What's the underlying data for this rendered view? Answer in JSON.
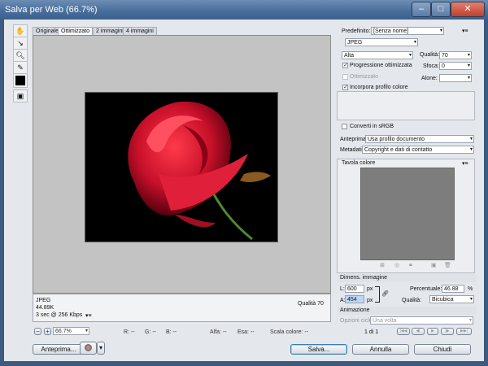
{
  "window": {
    "title": "Salva per Web (66.7%)",
    "minimize": "–",
    "maximize": "□",
    "close": "✕"
  },
  "tools": [
    "hand-icon",
    "slice-select-icon",
    "zoom-icon",
    "eyedropper-icon",
    "color-swatch-icon",
    "toggle-slices-icon"
  ],
  "tabs": [
    {
      "label": "Originale",
      "active": false
    },
    {
      "label": "Ottimizzato",
      "active": true
    },
    {
      "label": "2 immagini",
      "active": false
    },
    {
      "label": "4 immagini",
      "active": false
    }
  ],
  "info": {
    "format": "JPEG",
    "size": "44.89K",
    "time": "3 sec @ 256 Kbps",
    "quality": "Qualità 70"
  },
  "status": {
    "zoom": "66.7%",
    "r": "R: --",
    "g": "G: --",
    "b": "B: --",
    "alpha": "Alfa: --",
    "hex": "Esa: --",
    "index": "Scala colore: --"
  },
  "settings": {
    "preset_label": "Predefinito:",
    "preset_value": "[Senza nome]",
    "format": "JPEG",
    "compression": "Alta",
    "quality_label": "Qualità:",
    "quality_value": "70",
    "blur_label": "Sfoca:",
    "blur_value": "0",
    "matte_label": "Alone:",
    "progressive": "Progressione ottimizzata",
    "optimized": "Ottimizzato",
    "icc": "Incorpora profilo colore",
    "srgb": "Converti in sRGB",
    "preview_label": "Anteprima:",
    "preview_value": "Usa profilo documento",
    "metadata_label": "Metadati:",
    "metadata_value": "Copyright e dati di contatto"
  },
  "color_table": {
    "title": "Tavola colore"
  },
  "image_size": {
    "title": "Dimens. immagine",
    "w_label": "L:",
    "w_value": "600",
    "w_unit": "px",
    "h_label": "A:",
    "h_value": "454",
    "h_unit": "px",
    "percent_label": "Percentuale:",
    "percent_value": "46.88",
    "percent_unit": "%",
    "quality_label": "Qualità:",
    "quality_value": "Bicubica"
  },
  "animation": {
    "title": "Animazione",
    "loop_label": "Opzioni ciclo:",
    "loop_value": "Una volta",
    "frame": "1 di 1"
  },
  "buttons": {
    "preview": "Anteprima...",
    "save": "Salva...",
    "cancel": "Annulla",
    "done": "Chiudi"
  }
}
